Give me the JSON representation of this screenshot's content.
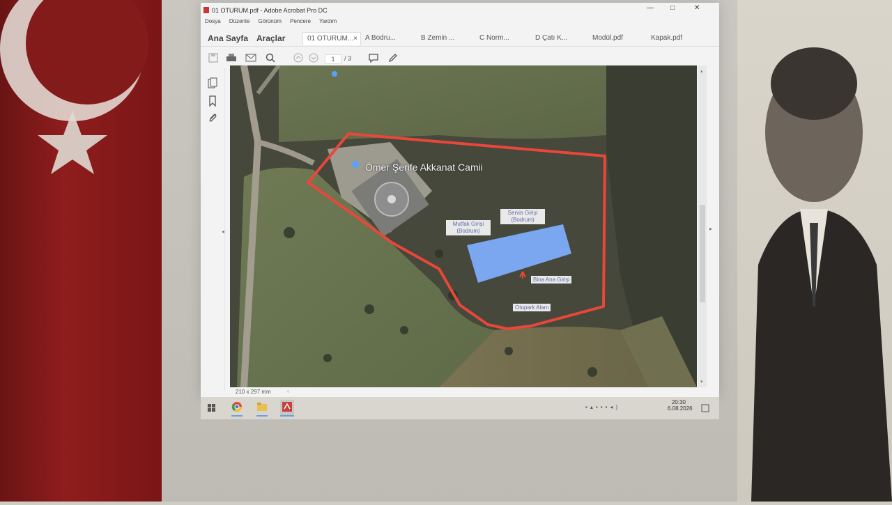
{
  "window": {
    "title": "01 OTURUM.pdf - Adobe Acrobat Pro DC",
    "minimize": "—",
    "maximize": "□",
    "close": "✕"
  },
  "menu": [
    "Dosya",
    "Düzenle",
    "Görünüm",
    "Pencere",
    "Yardım"
  ],
  "tabs": {
    "home": "Ana Sayfa",
    "tools": "Araçlar",
    "docs": [
      {
        "label": "01 OTURUM...",
        "close": "×"
      },
      {
        "label": "A Bodru..."
      },
      {
        "label": "B Zemin ..."
      },
      {
        "label": "C Norm..."
      },
      {
        "label": "D Çatı K..."
      },
      {
        "label": "Modül.pdf"
      },
      {
        "label": "Kapak.pdf"
      }
    ]
  },
  "toolbar": {
    "page_current": "1",
    "page_total": "/ 3"
  },
  "status": {
    "page_size": "210 x 297 mm"
  },
  "map_labels": {
    "mosque": "Ömer Şerife Akkanat Camii",
    "kitchen": "Mutfak Girişi\n(Bodrum)",
    "kitchen_l1": "Mutfak Girişi",
    "kitchen_l2": "(Bodrum)",
    "service_l1": "Servis Girişi",
    "service_l2": "(Bodrum)",
    "main_entrance": "Bina Ana Girişi",
    "parking": "Otopark Alanı"
  },
  "taskbar": {
    "time": "20:30",
    "date": "6.08.2026"
  },
  "colors": {
    "boundary": "#e8473a",
    "building": "#7aa7f0",
    "label_bg": "#e9e9e9"
  }
}
